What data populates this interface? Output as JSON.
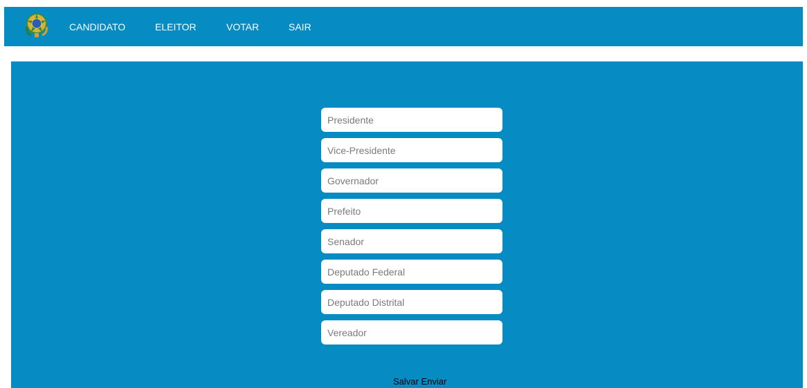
{
  "nav": {
    "logo_icon": "brazil-coat-of-arms-icon",
    "items": [
      {
        "label": "CANDIDATO"
      },
      {
        "label": "ELEITOR"
      },
      {
        "label": "VOTAR"
      },
      {
        "label": "SAIR"
      }
    ]
  },
  "form": {
    "fields": [
      {
        "placeholder": "Presidente",
        "value": ""
      },
      {
        "placeholder": "Vice-Presidente",
        "value": ""
      },
      {
        "placeholder": "Governador",
        "value": ""
      },
      {
        "placeholder": "Prefeito",
        "value": ""
      },
      {
        "placeholder": "Senador",
        "value": ""
      },
      {
        "placeholder": "Deputado Federal",
        "value": ""
      },
      {
        "placeholder": "Deputado Distrital",
        "value": ""
      },
      {
        "placeholder": "Vereador",
        "value": ""
      }
    ],
    "save_label": "Salvar",
    "send_label": "Enviar"
  },
  "colors": {
    "bar_background": "#068bc3",
    "panel_background": "#068bc3",
    "field_background": "#ffffff",
    "nav_text": "#ffffff"
  }
}
